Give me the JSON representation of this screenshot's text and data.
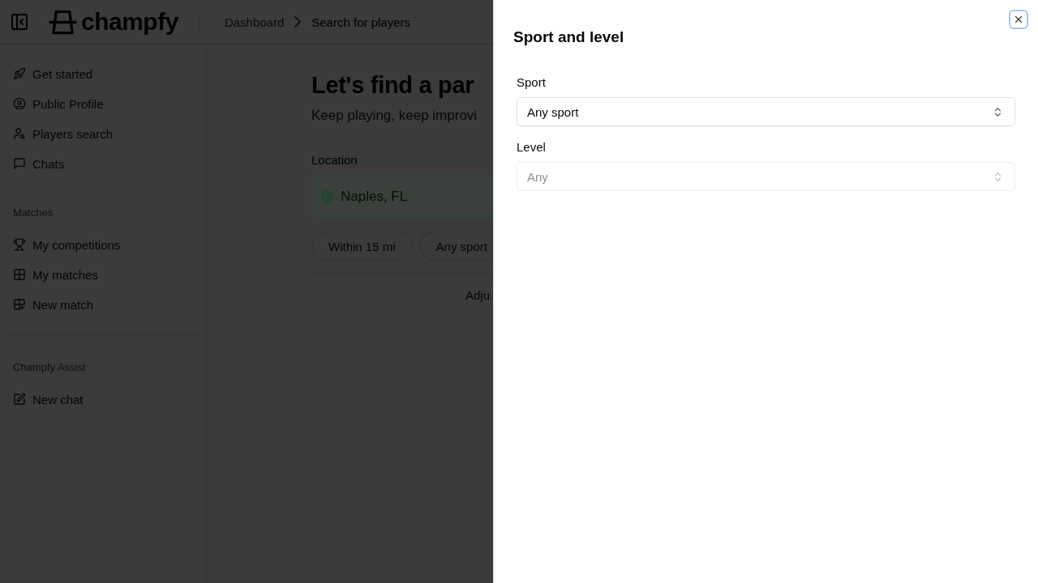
{
  "header": {
    "logo": "champfy",
    "breadcrumbs": [
      {
        "label": "Dashboard",
        "current": false
      },
      {
        "label": "Search for players",
        "current": true
      }
    ]
  },
  "sidebar": {
    "sections": [
      {
        "items": [
          "Get started",
          "Public Profile",
          "Players search",
          "Chats"
        ]
      },
      {
        "title": "Matches",
        "divider_above": false,
        "items": [
          "My competitions",
          "My matches",
          "New match"
        ]
      },
      {
        "title": "Champfy Assist",
        "divider_above": true,
        "items": [
          "New chat"
        ]
      }
    ]
  },
  "main": {
    "title": "Let's find a par",
    "subtitle": "Keep playing, keep improvi",
    "location": {
      "label": "Location",
      "value": "Naples, FL"
    },
    "filters": [
      "Within 15 mi",
      "Any sport"
    ],
    "hint": "Adju"
  },
  "drawer": {
    "title": "Sport and level",
    "close_button": {
      "focused": true
    },
    "fields": [
      {
        "label": "Sport",
        "value": "Any sport",
        "disabled": false
      },
      {
        "label": "Level",
        "value": "Any",
        "disabled": true
      }
    ]
  }
}
